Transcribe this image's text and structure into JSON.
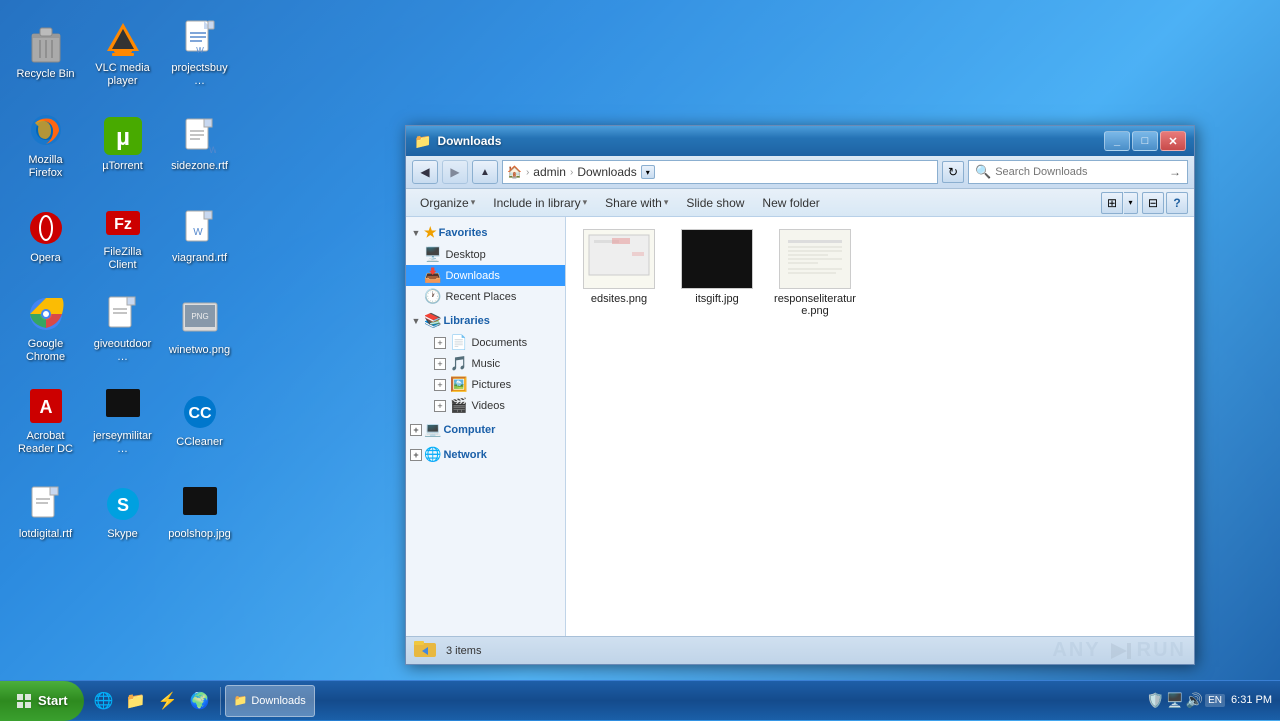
{
  "desktop": {
    "icons": [
      {
        "id": "recycle-bin",
        "label": "Recycle Bin",
        "icon": "🗑️"
      },
      {
        "id": "vlc",
        "label": "VLC media player",
        "icon": "🔶"
      },
      {
        "id": "projectsbuy",
        "label": "projectsbuy…",
        "icon": "📄"
      },
      {
        "id": "firefox",
        "label": "Mozilla Firefox",
        "icon": "🦊"
      },
      {
        "id": "utorrent",
        "label": "µTorrent",
        "icon": "🟩"
      },
      {
        "id": "sidezone",
        "label": "sidezone.rtf",
        "icon": "📝"
      },
      {
        "id": "opera",
        "label": "Opera",
        "icon": "🔴"
      },
      {
        "id": "filezilla",
        "label": "FileZilla Client",
        "icon": "🟦"
      },
      {
        "id": "viagrand",
        "label": "viagrand.rtf",
        "icon": "📝"
      },
      {
        "id": "chrome",
        "label": "Google Chrome",
        "icon": "🌐"
      },
      {
        "id": "giveoutdoor",
        "label": "giveoutdoor…",
        "icon": "📝"
      },
      {
        "id": "winetwo",
        "label": "winetwo.png",
        "icon": "🖼️"
      },
      {
        "id": "acrobat",
        "label": "Acrobat Reader DC",
        "icon": "📕"
      },
      {
        "id": "jerseymilitar",
        "label": "jerseymilitar…",
        "icon": "⬛"
      },
      {
        "id": "ccleaner",
        "label": "CCleaner",
        "icon": "🧹"
      },
      {
        "id": "lotdigital",
        "label": "lotdigital.rtf",
        "icon": "📝"
      },
      {
        "id": "skype",
        "label": "Skype",
        "icon": "🔵"
      },
      {
        "id": "poolshop",
        "label": "poolshop.jpg",
        "icon": "⬛"
      }
    ]
  },
  "explorer": {
    "title": "Downloads",
    "title_icon": "📁",
    "nav": {
      "back_disabled": false,
      "forward_disabled": true,
      "address_parts": [
        "admin",
        "Downloads"
      ],
      "search_placeholder": "Search Downloads"
    },
    "menu": {
      "organize": "Organize",
      "include_library": "Include in library",
      "share_with": "Share with",
      "slideshow": "Slide show",
      "new_folder": "New folder"
    },
    "sidebar": {
      "favorites_label": "Favorites",
      "items_favorites": [
        {
          "label": "Desktop",
          "indent": 1
        },
        {
          "label": "Downloads",
          "indent": 1,
          "selected": true
        },
        {
          "label": "Recent Places",
          "indent": 1
        }
      ],
      "libraries_label": "Libraries",
      "items_libraries": [
        {
          "label": "Documents",
          "indent": 2
        },
        {
          "label": "Music",
          "indent": 2
        },
        {
          "label": "Pictures",
          "indent": 2
        },
        {
          "label": "Videos",
          "indent": 2
        }
      ],
      "computer_label": "Computer",
      "network_label": "Network"
    },
    "files": [
      {
        "name": "edsites.png",
        "type": "png",
        "thumb": "edsites"
      },
      {
        "name": "itsgift.jpg",
        "type": "jpg",
        "thumb": "itsgift"
      },
      {
        "name": "responseliterature.png",
        "type": "png",
        "thumb": "response"
      }
    ],
    "status": {
      "item_count": "3 items"
    }
  },
  "taskbar": {
    "start_label": "Start",
    "quick_items": [
      "🌐",
      "📁",
      "⚡",
      "🌍"
    ],
    "active_window": "Downloads",
    "tray_icons": [
      "🔊",
      "🌐",
      "🛡️"
    ],
    "clock": "6:31 PM",
    "date": ""
  }
}
